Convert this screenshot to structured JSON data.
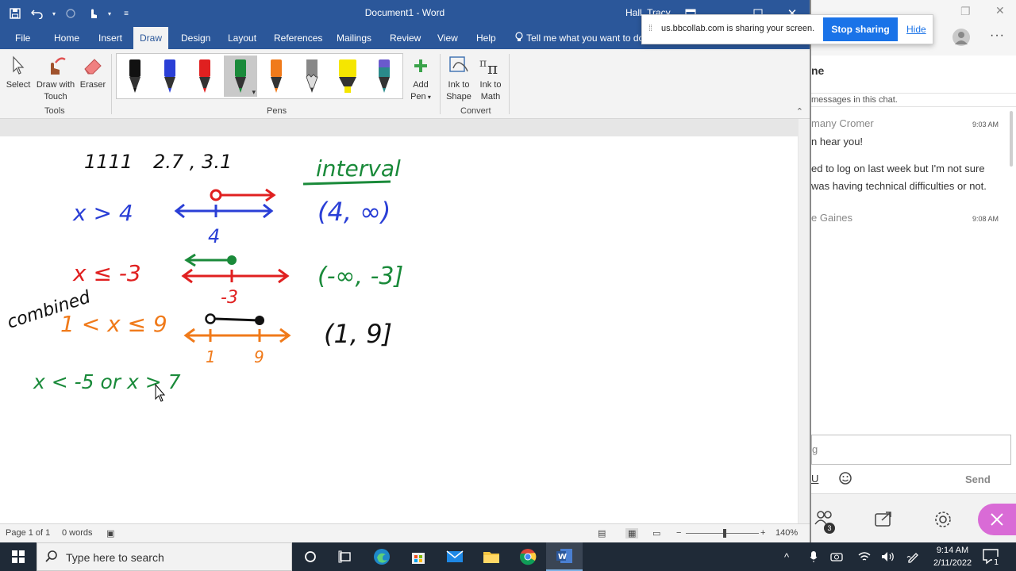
{
  "word": {
    "doc_title": "Document1  -  Word",
    "user_name": "Hall, Tracy",
    "tabs": [
      "File",
      "Home",
      "Insert",
      "Draw",
      "Design",
      "Layout",
      "References",
      "Mailings",
      "Review",
      "View",
      "Help"
    ],
    "active_tab": "Draw",
    "tell_me": "Tell me what you want to do",
    "ribbon": {
      "tools": {
        "select": "Select",
        "draw_touch_1": "Draw with",
        "draw_touch_2": "Touch",
        "eraser": "Eraser",
        "group": "Tools"
      },
      "pens_group": "Pens",
      "pen_colors": [
        "#111111",
        "#2a3fd6",
        "#e02020",
        "#1a8a3a",
        "#f07a1a",
        "#888888",
        "#f5e600",
        "#2a8a8a"
      ],
      "add_pen_1": "Add",
      "add_pen_2": "Pen",
      "convert": {
        "ink_shape_1": "Ink to",
        "ink_shape_2": "Shape",
        "ink_math_1": "Ink to",
        "ink_math_2": "Math",
        "group": "Convert"
      }
    },
    "status": {
      "page": "Page 1 of 1",
      "words": "0 words",
      "zoom": "140%"
    }
  },
  "ink": {
    "notes_top": [
      "1111",
      "2.7 , 3.1"
    ],
    "heading": "interval",
    "rows": [
      {
        "inequality": "x > 4",
        "color": "#2a3fd6",
        "tick": "4",
        "interval": "(4, ∞)",
        "interval_color": "#2a3fd6"
      },
      {
        "inequality": "x ≤ -3",
        "color": "#e02020",
        "tick": "-3",
        "interval": "(-∞, -3]",
        "interval_color": "#1a8a3a"
      },
      {
        "inequality": "1 < x ≤ 9",
        "color": "#f07a1a",
        "ticks": [
          "1",
          "9"
        ],
        "interval": "(1, 9]",
        "interval_color": "#111111"
      },
      {
        "inequality": "x < -5  or  x > 7",
        "color": "#1a8a3a"
      }
    ],
    "side_note": "combined"
  },
  "collab": {
    "chat_title": "ne",
    "notice": "messages in this chat.",
    "messages": [
      {
        "author": "many Cromer",
        "time": "9:03 AM",
        "lines": [
          "n hear you!",
          "ed to log on last week but I'm not sure",
          "was having technical difficulties or not."
        ]
      },
      {
        "author": "e Gaines",
        "time": "9:08 AM",
        "lines": []
      }
    ],
    "input_placeholder": "g",
    "send": "Send",
    "attendee_count": "3",
    "accent": "#d96bd6"
  },
  "sharebar": {
    "text": "us.bbcollab.com is sharing your screen.",
    "stop": "Stop sharing",
    "hide": "Hide"
  },
  "taskbar": {
    "search_placeholder": "Type here to search",
    "time": "9:14 AM",
    "date": "2/11/2022"
  }
}
